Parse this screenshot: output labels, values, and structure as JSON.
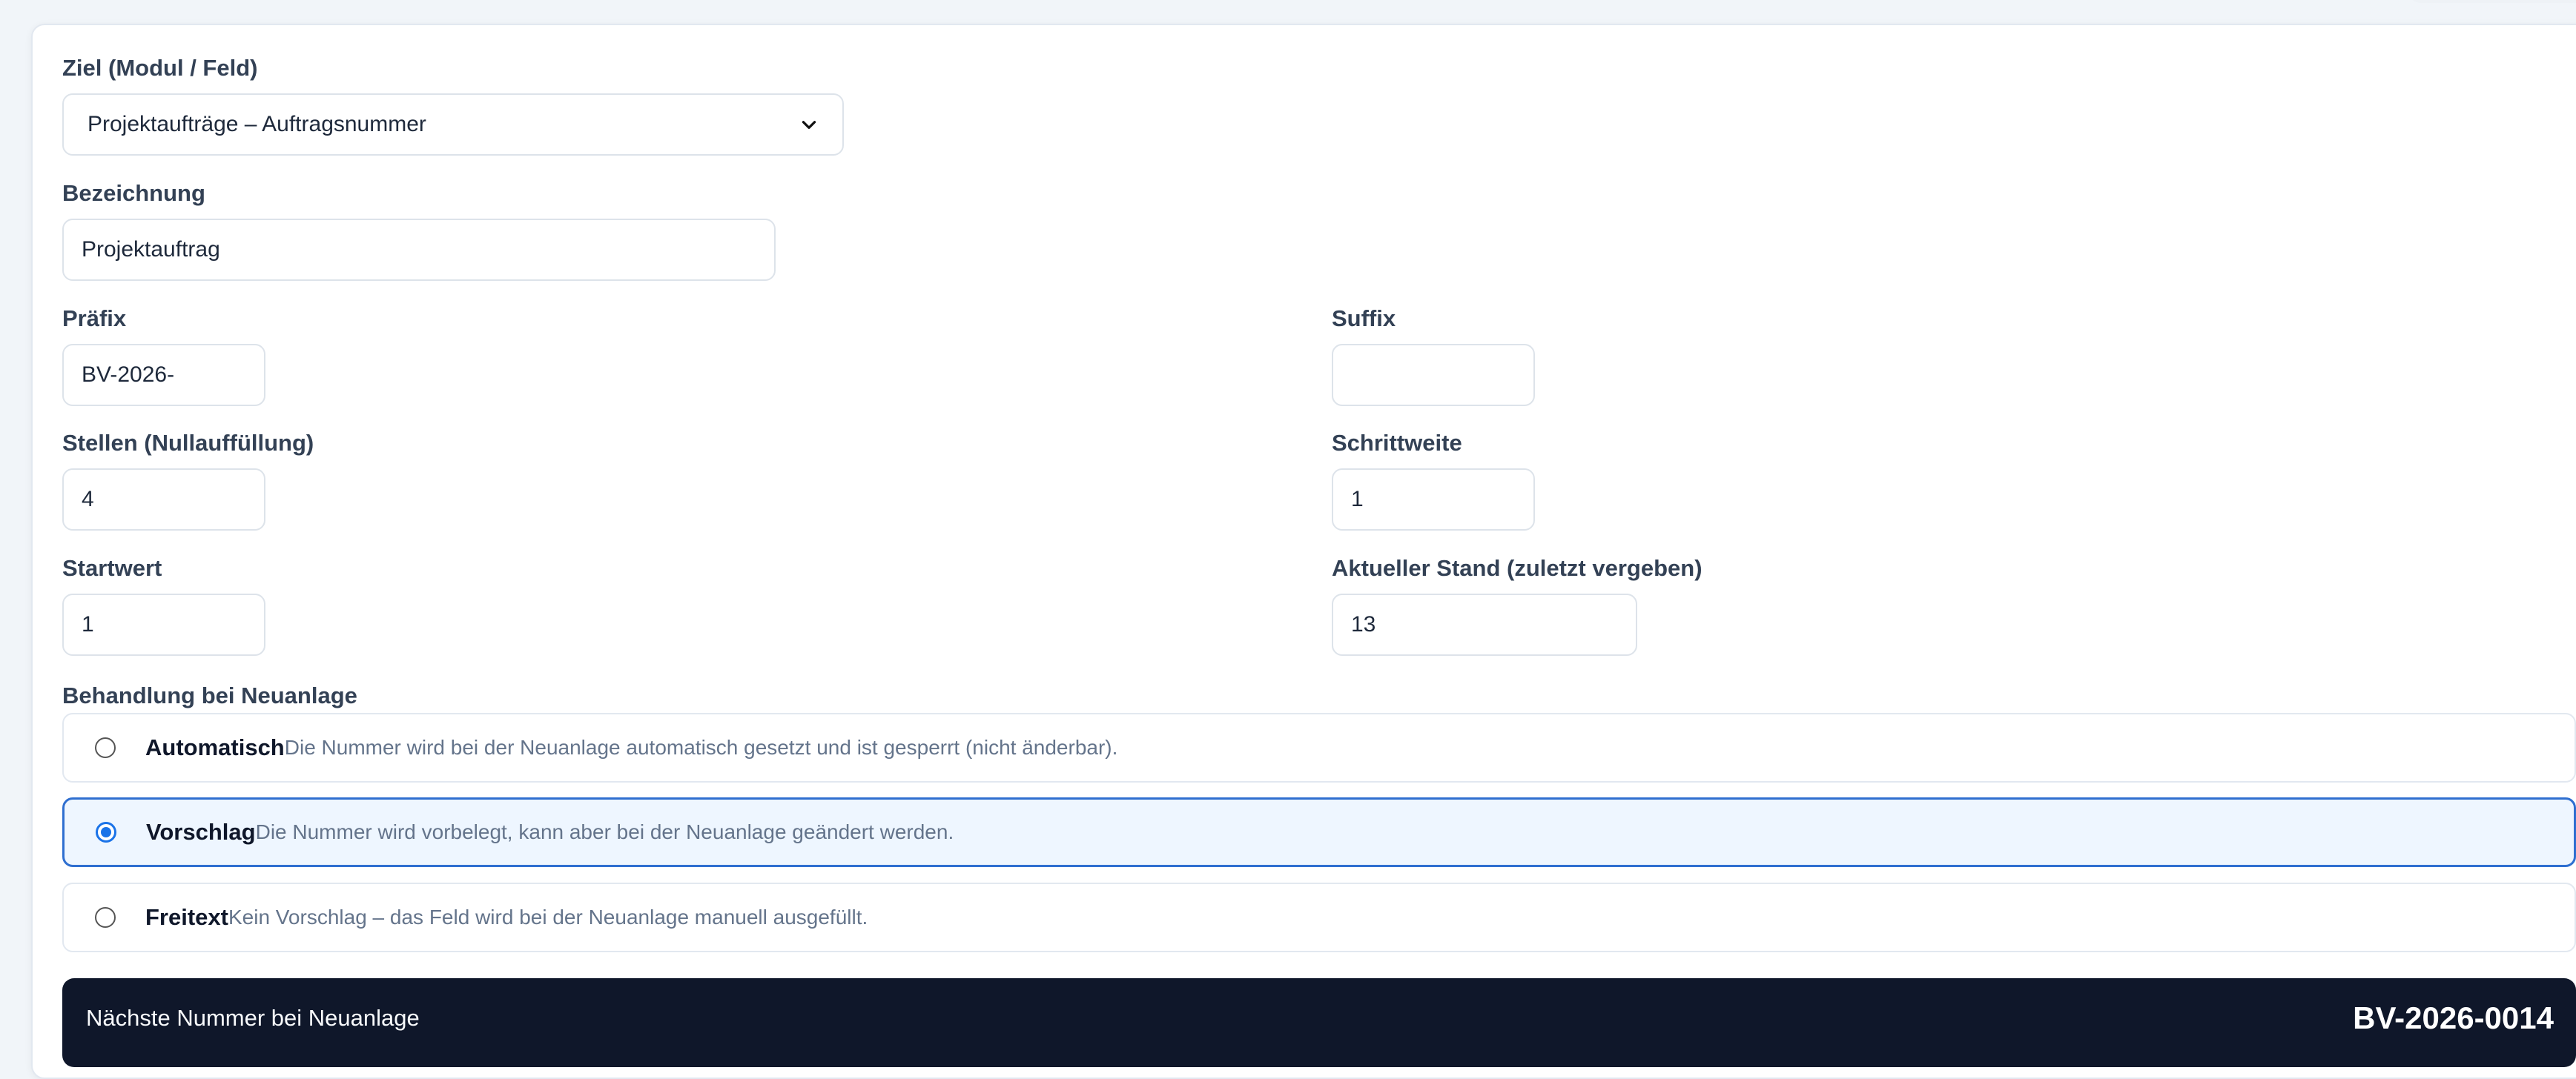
{
  "form": {
    "target_label": "Ziel (Modul / Feld)",
    "target_value": "Projektaufträge – Auftragsnummer",
    "name_label": "Bezeichnung",
    "name_value": "Projektauftrag",
    "prefix_label": "Präfix",
    "prefix_value": "BV-2026-",
    "suffix_label": "Suffix",
    "suffix_value": "",
    "digits_label": "Stellen (Nullauffüllung)",
    "digits_value": "4",
    "step_label": "Schrittweite",
    "step_value": "1",
    "start_label": "Startwert",
    "start_value": "1",
    "current_label": "Aktueller Stand (zuletzt vergeben)",
    "current_value": "13",
    "mode_label": "Behandlung bei Neuanlage"
  },
  "modes": [
    {
      "title": "Automatisch",
      "desc": "Die Nummer wird bei der Neuanlage automatisch gesetzt und ist gesperrt (nicht änderbar).",
      "selected": false
    },
    {
      "title": "Vorschlag",
      "desc": "Die Nummer wird vorbelegt, kann aber bei der Neuanlage geändert werden.",
      "selected": true
    },
    {
      "title": "Freitext",
      "desc": "Kein Vorschlag – das Feld wird bei der Neuanlage manuell ausgefüllt.",
      "selected": false
    }
  ],
  "next": {
    "label": "Nächste Nummer bei Neuanlage",
    "value": "BV-2026-0014"
  },
  "colors": {
    "accent": "#1a73e8",
    "selected_bg": "#eef6ff",
    "dark_bar": "#0f172a"
  }
}
